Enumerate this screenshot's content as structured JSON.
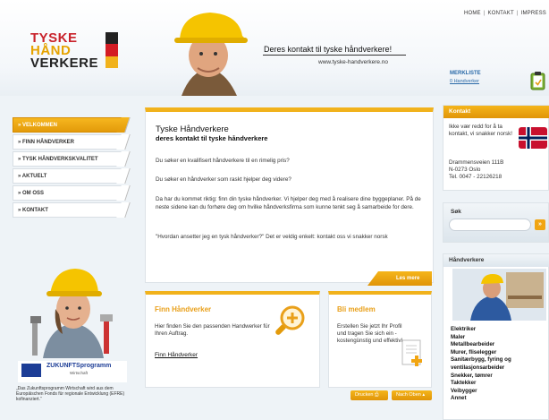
{
  "topnav": {
    "home": "HOME",
    "kontakt": "KONTAKT",
    "impressum": "IMPRESS"
  },
  "logo": {
    "line1": "TYSKE",
    "line2": "HÅND",
    "line3": "VERKERE"
  },
  "header": {
    "tagline": "Deres kontakt til tyske håndverkere!",
    "website": "www.tyske-handverkere.no"
  },
  "merkliste": {
    "title": "MERKLISTE",
    "count": "0 Handverker",
    "icon": "clipboard-icon"
  },
  "nav": [
    {
      "label": "» VELKOMMEN",
      "active": true
    },
    {
      "label": "» FINN HÅNDVERKER",
      "active": false
    },
    {
      "label": "» TYSK HÅNDVERKSKVALITET",
      "active": false
    },
    {
      "label": "» AKTUELT",
      "active": false
    },
    {
      "label": "» OM OSS",
      "active": false
    },
    {
      "label": "» KONTAKT",
      "active": false
    }
  ],
  "promo": {
    "zuk_title": "ZUKUNFTSprogramm",
    "zuk_sub": "Wirtschaft",
    "quote": "„Das Zukunftsprogramm Wirtschaft wird aus dem Europäischen Fonds für regionale Entwicklung (EFRE) kofinanziert.“"
  },
  "main": {
    "title": "Tyske Håndverkere",
    "subtitle": "deres kontakt til tyske håndverkere",
    "p1": "Du søker en kvalifisert håndverkere til en rimelig pris?",
    "p2": "Du søker en håndverker som raskt hjelper deg videre?",
    "p3": "Da har du kommet riktig: finn din tyske håndverker. Vi hjelper deg med å realisere dine byggeplaner. På de neste sidene kan du forhøre deg om hvilke håndverksfirma som kunne tenkt seg å samarbeide for dere.",
    "p4": "\"Hvordan ansetter jeg en tysk håndverker?\" Det er veldig enkelt: kontakt oss vi snakker norsk",
    "read_more": "Les mere"
  },
  "finn": {
    "title": "Finn Håndverker",
    "text": "Hier finden Sie den passenden Handwerker für Ihren Auftrag.",
    "link": "Finn Håndverker",
    "icon": "magnifier-plus-icon"
  },
  "bli": {
    "title": "Bli medlem",
    "text": "Erstellen Sie jetzt Ihr Profil und tragen Sie sich ein - kostengünstig und effektiv!",
    "icon": "document-plus-icon"
  },
  "buttons": {
    "print": "Drucken",
    "top": "Nach Oben"
  },
  "kontakt": {
    "title": "Kontakt",
    "text": "Ikke vær redd for å ta kontakt, vi snakker norsk!",
    "address": [
      "Drammensveien 111B",
      "N-0273 Oslo",
      "Tel. 0047 - 22126218"
    ]
  },
  "sok": {
    "label": "Søk",
    "placeholder": "",
    "button": "»"
  },
  "handverkere": {
    "title": "Håndverkere",
    "items": [
      "Elektriker",
      "Maler",
      "Metallbearbeider",
      "Murer, fliselegger",
      "Sanitærbygg, fyring og ventilasjonsarbeider",
      "Snekker, tømrer",
      "Taktekker",
      "Veibygger",
      "Annet"
    ]
  },
  "colors": {
    "accent": "#f1b21c",
    "red": "#c9222b",
    "gold": "#e6a300",
    "link": "#2a6aa8"
  }
}
